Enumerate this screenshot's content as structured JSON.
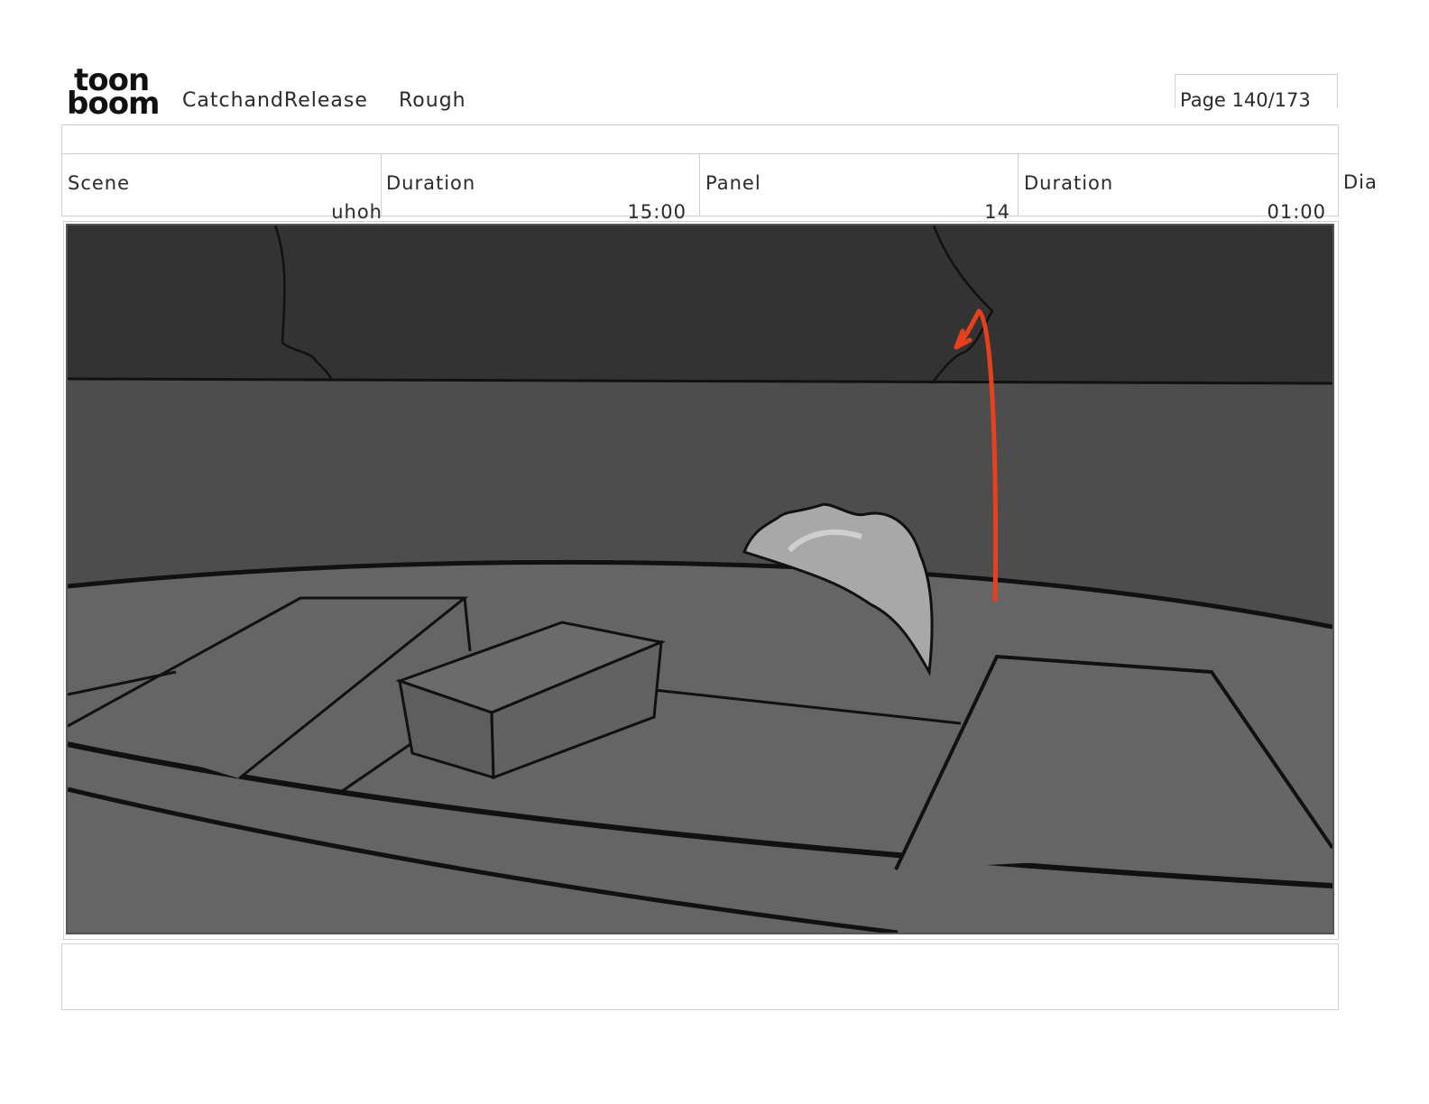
{
  "brand": {
    "logo_line1": "toon",
    "logo_line2": "boom"
  },
  "header": {
    "project": "CatchandRelease",
    "stage": "Rough",
    "page": "Page 140/173"
  },
  "fields": [
    {
      "label": "Scene",
      "value": "uhoh"
    },
    {
      "label": "Duration",
      "value": "15:00"
    },
    {
      "label": "Panel",
      "value": "14"
    },
    {
      "label": "Duration",
      "value": "01:00"
    }
  ],
  "dialogue_label": "Dia",
  "colors": {
    "sky": "#333333",
    "water": "#4d4d4d",
    "boat": "#656565",
    "fin": "#a8a8a8",
    "arrow": "#e8401c"
  }
}
